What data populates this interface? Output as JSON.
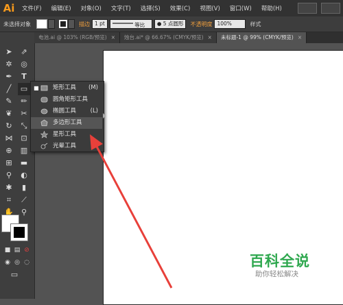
{
  "app": {
    "logo": "Ai"
  },
  "menu": [
    "文件(F)",
    "编辑(E)",
    "对象(O)",
    "文字(T)",
    "选择(S)",
    "效果(C)",
    "视图(V)",
    "窗口(W)",
    "帮助(H)"
  ],
  "control_bar": {
    "selection_label": "未选择对象",
    "stroke_label": "描边",
    "stroke_weight": "1 pt",
    "uniform_label": "等比",
    "brush_label": "5 点圆形",
    "opacity_label": "不透明度",
    "opacity_value": "100%",
    "style_label": "样式"
  },
  "tabs": [
    {
      "label": "电池.ai @ 103% (RGB/预览)",
      "active": false
    },
    {
      "label": "烛台.ai* @ 66.67% (CMYK/预览)",
      "active": false
    },
    {
      "label": "未标题-1 @ 99% (CMYK/预览)",
      "active": true
    }
  ],
  "flyout": {
    "items": [
      {
        "label": "矩形工具",
        "shortcut": "(M)",
        "icon": "rectangle-icon",
        "selected": true
      },
      {
        "label": "圆角矩形工具",
        "shortcut": "",
        "icon": "rounded-rectangle-icon",
        "selected": false
      },
      {
        "label": "椭圆工具",
        "shortcut": "(L)",
        "icon": "ellipse-icon",
        "selected": false
      },
      {
        "label": "多边形工具",
        "shortcut": "",
        "icon": "polygon-icon",
        "selected": false
      },
      {
        "label": "星形工具",
        "shortcut": "",
        "icon": "star-icon",
        "selected": false
      },
      {
        "label": "光晕工具",
        "shortcut": "",
        "icon": "flare-icon",
        "selected": false
      }
    ]
  },
  "watermark": {
    "title": "百科全说",
    "subtitle": "助你轻松解决"
  },
  "colors": {
    "accent": "#f79a1c",
    "arrow": "#e8403a",
    "watermark": "#2fa84f"
  }
}
